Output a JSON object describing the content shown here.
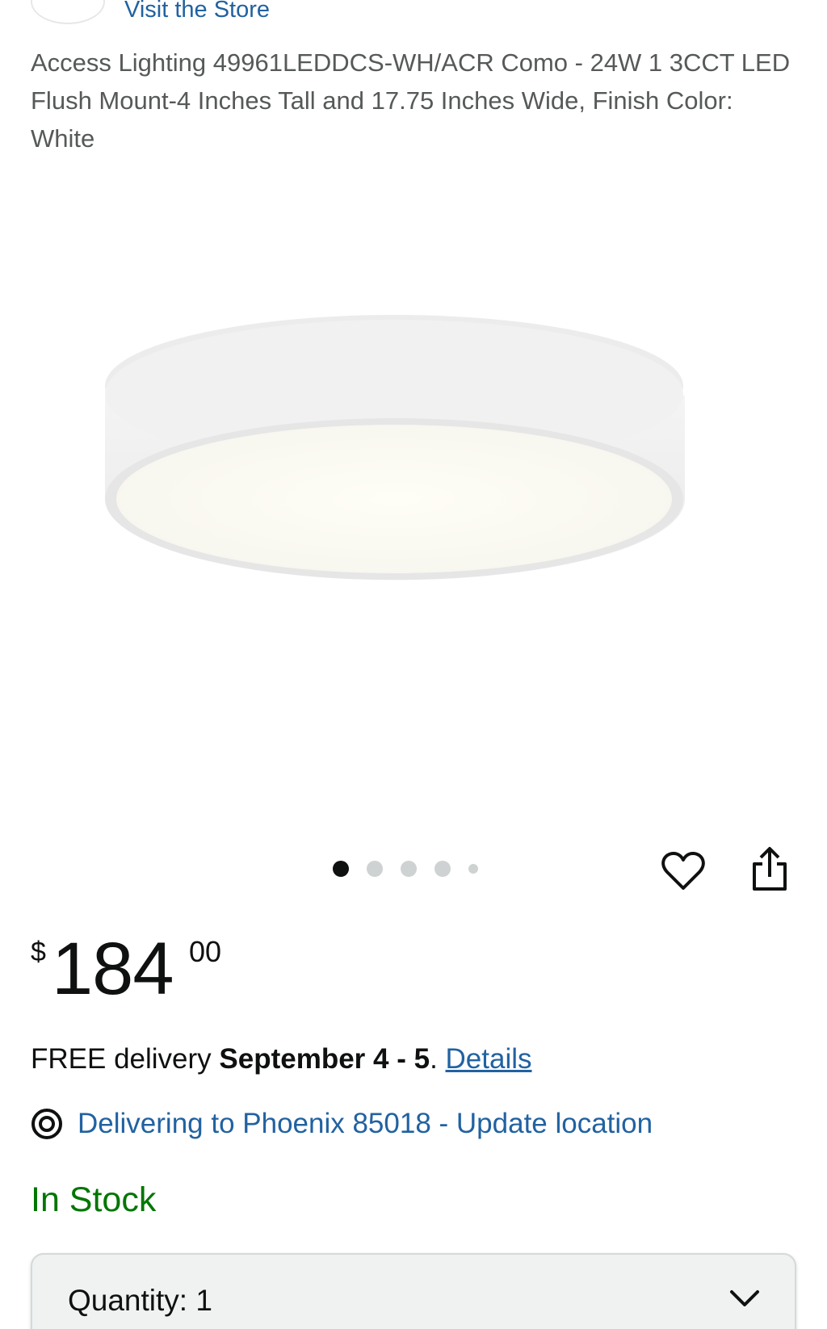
{
  "store": {
    "link_label": "Visit the Store"
  },
  "product": {
    "title": "Access Lighting 49961LEDDCS-WH/ACR Como - 24W 1 3CCT LED Flush Mount-4 Inches Tall and 17.75 Inches Wide, Finish Color: White",
    "image_count": 5,
    "active_image_index": 0
  },
  "price": {
    "symbol": "$",
    "whole": "184",
    "fraction": "00"
  },
  "delivery": {
    "prefix": "FREE delivery ",
    "date": "September 4 - 5",
    "separator": ". ",
    "details_label": "Details"
  },
  "location": {
    "text": "Delivering to Phoenix 85018 - Update location"
  },
  "availability": {
    "text": "In Stock",
    "color": "#007600"
  },
  "quantity": {
    "label": "Quantity:",
    "value": "1"
  },
  "icons": {
    "wishlist": "heart-icon",
    "share": "share-icon",
    "location": "location-pin-icon",
    "dropdown": "chevron-down-icon"
  },
  "colors": {
    "link": "#2162a1",
    "text": "#0f1111",
    "secondary_text": "#565959",
    "in_stock": "#007600"
  }
}
